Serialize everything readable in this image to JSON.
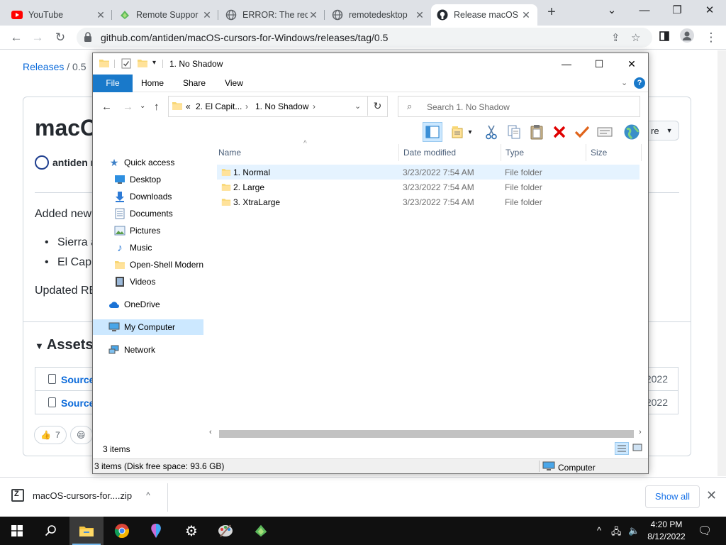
{
  "browser": {
    "tabs": [
      {
        "title": "YouTube",
        "icon": "youtube-icon"
      },
      {
        "title": "Remote Suppor",
        "icon": "remote-support-icon"
      },
      {
        "title": "ERROR: The req",
        "icon": "globe-icon"
      },
      {
        "title": "remotedesktop",
        "icon": "globe-icon"
      },
      {
        "title": "Release macOS",
        "icon": "github-icon",
        "active": true
      }
    ],
    "new_tab": "+",
    "url": "github.com/antiden/macOS-cursors-for-Windows/releases/tag/0.5"
  },
  "github": {
    "breadcrumb_link": "Releases",
    "breadcrumb_sep": "/",
    "breadcrumb_current": "0.5",
    "title": "macO",
    "author": "antiden r",
    "added_text": "Added new",
    "bullets": [
      "Sierra a",
      "El Capi"
    ],
    "updated_text": "Updated RE",
    "assets_title": "Assets",
    "assets": [
      {
        "name": "Source",
        "date": "2022"
      },
      {
        "name": "Source",
        "date": "2022"
      }
    ],
    "reaction_count": "7",
    "button_fragment": "re"
  },
  "downloads": {
    "file": "macOS-cursors-for....zip",
    "show_all": "Show all"
  },
  "taskbar": {
    "time": "4:20 PM",
    "date": "8/12/2022"
  },
  "explorer": {
    "title": "1. No Shadow",
    "ribbon_tabs": [
      "File",
      "Home",
      "Share",
      "View"
    ],
    "help": "?",
    "address": {
      "overflow": "«",
      "segment1": "2. El Capit...",
      "segment2": "1. No Shadow"
    },
    "search_placeholder": "Search 1. No Shadow",
    "nav": {
      "quick_access": "Quick access",
      "desktop": "Desktop",
      "downloads": "Downloads",
      "documents": "Documents",
      "pictures": "Pictures",
      "music": "Music",
      "open_shell": "Open-Shell Modern",
      "videos": "Videos",
      "onedrive": "OneDrive",
      "my_computer": "My Computer",
      "network": "Network"
    },
    "columns": {
      "name": "Name",
      "date": "Date modified",
      "type": "Type",
      "size": "Size"
    },
    "files": [
      {
        "name": "1. Normal",
        "date": "3/23/2022 7:54 AM",
        "type": "File folder"
      },
      {
        "name": "2. Large",
        "date": "3/23/2022 7:54 AM",
        "type": "File folder"
      },
      {
        "name": "3. XtraLarge",
        "date": "3/23/2022 7:54 AM",
        "type": "File folder"
      }
    ],
    "item_count": "3 items",
    "status_text": "3 items (Disk free space: 93.6 GB)",
    "status_location": "Computer"
  },
  "colors": {
    "ribbon_file": "#1979ca",
    "selection": "#cce8ff",
    "github_link": "#0969da"
  }
}
